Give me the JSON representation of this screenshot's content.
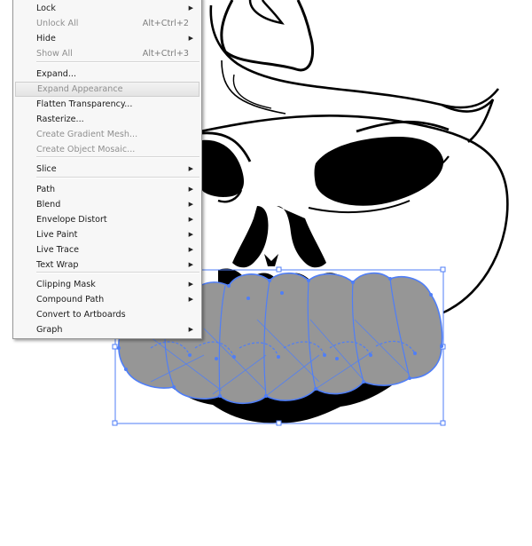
{
  "context_menu": {
    "items": [
      {
        "label": "Lock",
        "shortcut": "",
        "submenu": true,
        "enabled": true
      },
      {
        "label": "Unlock All",
        "shortcut": "Alt+Ctrl+2",
        "submenu": false,
        "enabled": false
      },
      {
        "label": "Hide",
        "shortcut": "",
        "submenu": true,
        "enabled": true
      },
      {
        "label": "Show All",
        "shortcut": "Alt+Ctrl+3",
        "submenu": false,
        "enabled": false
      },
      {
        "label": "Expand...",
        "shortcut": "",
        "submenu": false,
        "enabled": true
      },
      {
        "label": "Expand Appearance",
        "shortcut": "",
        "submenu": false,
        "enabled": false,
        "highlighted": true
      },
      {
        "label": "Flatten Transparency...",
        "shortcut": "",
        "submenu": false,
        "enabled": true
      },
      {
        "label": "Rasterize...",
        "shortcut": "",
        "submenu": false,
        "enabled": true
      },
      {
        "label": "Create Gradient Mesh...",
        "shortcut": "",
        "submenu": false,
        "enabled": false
      },
      {
        "label": "Create Object Mosaic...",
        "shortcut": "",
        "submenu": false,
        "enabled": false
      },
      {
        "label": "Slice",
        "shortcut": "",
        "submenu": true,
        "enabled": true
      },
      {
        "label": "Path",
        "shortcut": "",
        "submenu": true,
        "enabled": true
      },
      {
        "label": "Blend",
        "shortcut": "",
        "submenu": true,
        "enabled": true
      },
      {
        "label": "Envelope Distort",
        "shortcut": "",
        "submenu": true,
        "enabled": true
      },
      {
        "label": "Live Paint",
        "shortcut": "",
        "submenu": true,
        "enabled": true
      },
      {
        "label": "Live Trace",
        "shortcut": "",
        "submenu": true,
        "enabled": true
      },
      {
        "label": "Text Wrap",
        "shortcut": "",
        "submenu": true,
        "enabled": true
      },
      {
        "label": "Clipping Mask",
        "shortcut": "",
        "submenu": true,
        "enabled": true
      },
      {
        "label": "Compound Path",
        "shortcut": "",
        "submenu": true,
        "enabled": true
      },
      {
        "label": "Convert to Artboards",
        "shortcut": "",
        "submenu": false,
        "enabled": true
      },
      {
        "label": "Graph",
        "shortcut": "",
        "submenu": true,
        "enabled": true
      }
    ]
  },
  "icons": {
    "submenu_arrow": "triangle-right-icon"
  },
  "colors": {
    "selection_blue": "#4f7ef7",
    "mouth_fill": "#969696",
    "ink": "#000000",
    "menu_bg": "#f7f7f7",
    "disabled_text": "#8f8f8f"
  }
}
